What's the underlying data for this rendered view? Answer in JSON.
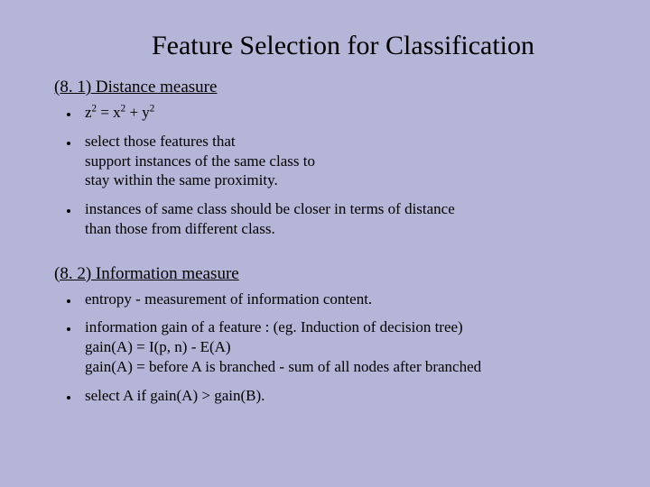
{
  "slide": {
    "title": "Feature Selection for Classification",
    "section1": {
      "heading": "(8. 1) Distance measure",
      "bullets": [
        {
          "formula": {
            "z_base": "z",
            "z_sup": "2",
            "eq": " = ",
            "x_base": "x",
            "x_sup": "2",
            "plus": " + ",
            "y_base": "y",
            "y_sup": "2"
          }
        },
        {
          "text": "select those features that\nsupport instances of the same class to\nstay within the same proximity."
        },
        {
          "text": "instances of same class should be closer in terms of distance\nthan those from different class."
        }
      ]
    },
    "section2": {
      "heading": "(8. 2) Information measure",
      "bullets": [
        {
          "text": "entropy - measurement of information content."
        },
        {
          "text": "information gain of a feature : (eg. Induction of decision tree)\ngain(A) = I(p, n) - E(A)\ngain(A) = before A is branched - sum of all nodes after branched"
        },
        {
          "text": "select A if gain(A) > gain(B)."
        }
      ]
    }
  }
}
